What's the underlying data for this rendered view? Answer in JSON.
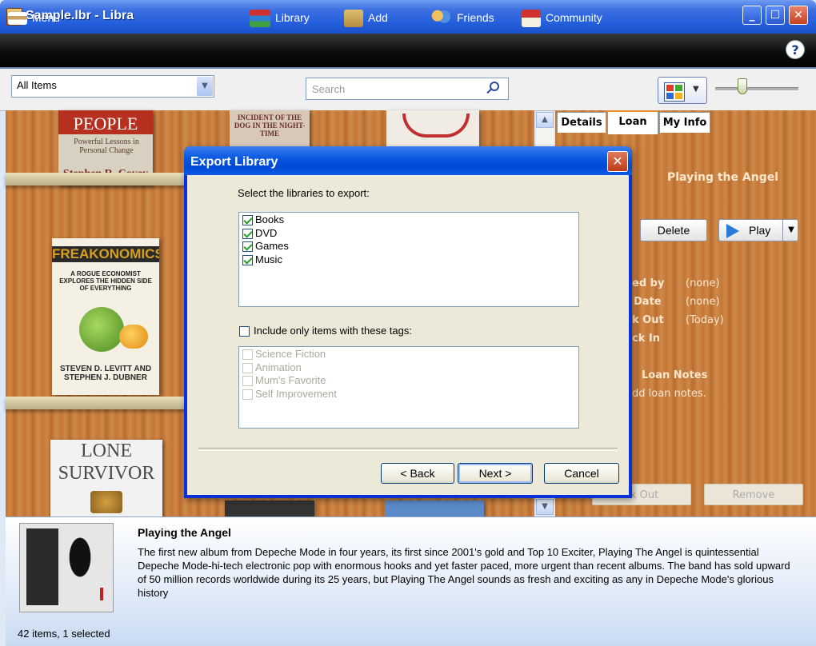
{
  "window": {
    "title": "Sample.lbr - Libra"
  },
  "toolbar": {
    "menu": "Menu",
    "library": "Library",
    "add": "Add",
    "friends": "Friends",
    "community": "Community",
    "help": "?"
  },
  "filter": {
    "selected": "All Items",
    "search_placeholder": "Search"
  },
  "shelf": {
    "books": [
      {
        "title": "PEOPLE",
        "sub": "Powerful Lessons in Personal Change",
        "author": "Stephen R. Covey"
      },
      {
        "title": "INCIDENT OF THE DOG IN THE NIGHT-TIME"
      },
      {
        "title": "FREAKONOMICS",
        "sub": "A ROGUE ECONOMIST EXPLORES THE HIDDEN SIDE OF EVERYTHING",
        "author": "STEVEN D. LEVITT AND STEPHEN J. DUBNER"
      },
      {
        "title": "LONE SURVIVOR"
      }
    ]
  },
  "right_panel": {
    "tabs": [
      "Details",
      "Loan",
      "My Info"
    ],
    "active_tab": "Loan",
    "item_title": "Playing the Angel",
    "delete": "Delete",
    "play": "Play",
    "fields": [
      {
        "label": "ed by",
        "value": "(none)"
      },
      {
        "label": "Date",
        "value": "(none)"
      },
      {
        "label": "k Out",
        "value": "(Today)"
      },
      {
        "label": "ck In",
        "value": ""
      }
    ],
    "loan_notes_label": "Loan Notes",
    "loan_notes_hint": "dd loan notes.",
    "checkout": "ck Out",
    "remove": "Remove"
  },
  "info": {
    "title": "Playing the Angel",
    "description": "The first new album from Depeche Mode in four years, its first since 2001's gold and Top 10 Exciter, Playing The Angel is quintessential Depeche Mode-hi-tech electronic pop with enormous hooks and yet faster paced, more urgent than recent albums. The band has sold upward of 50 million records worldwide during its 25 years, but Playing The Angel sounds as fresh and exciting as any in Depeche Mode's glorious history",
    "status": "42 items, 1 selected"
  },
  "dialog": {
    "title": "Export Library",
    "prompt": "Select the libraries to export:",
    "libraries": [
      {
        "label": "Books",
        "checked": true
      },
      {
        "label": "DVD",
        "checked": true
      },
      {
        "label": "Games",
        "checked": true
      },
      {
        "label": "Music",
        "checked": true
      }
    ],
    "tags_option": "Include only items with these tags:",
    "tags": [
      "Science Fiction",
      "Animation",
      "Mum's Favorite",
      "Self Improvement"
    ],
    "back": "< Back",
    "next": "Next >",
    "cancel": "Cancel"
  }
}
